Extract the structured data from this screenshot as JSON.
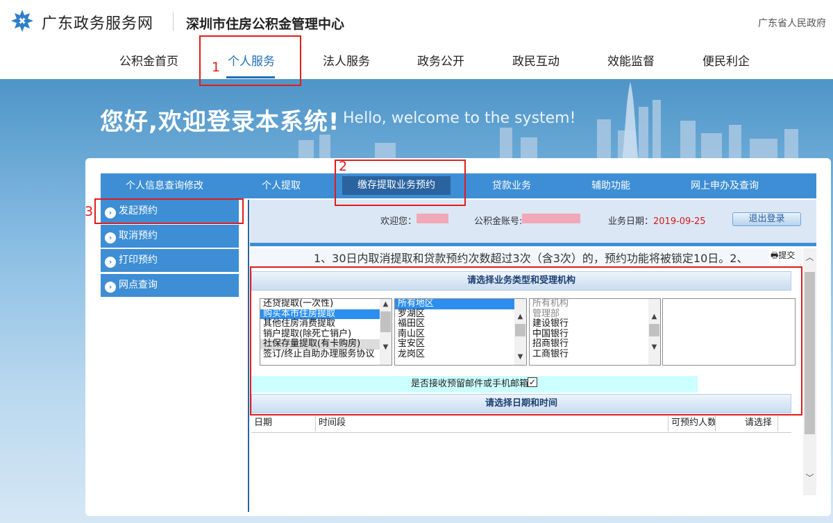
{
  "header": {
    "site_name": "广东政务服务网",
    "org_name": "深圳市住房公积金管理中心",
    "gov_link": "广东省人民政府"
  },
  "main_nav": [
    {
      "label": "公积金首页"
    },
    {
      "label": "个人服务",
      "active": true
    },
    {
      "label": "法人服务"
    },
    {
      "label": "政务公开"
    },
    {
      "label": "政民互动"
    },
    {
      "label": "效能监督"
    },
    {
      "label": "便民利企"
    }
  ],
  "banner": {
    "title": "您好,欢迎登录本系统!",
    "subtitle": "Hello, welcome to the system!"
  },
  "sub_nav": [
    {
      "label": "个人信息查询修改"
    },
    {
      "label": "个人提取"
    },
    {
      "label": "缴存提取业务预约",
      "active": true
    },
    {
      "label": "贷款业务"
    },
    {
      "label": "辅助功能"
    },
    {
      "label": "网上申办及查询"
    }
  ],
  "sidebar": [
    {
      "label": "发起预约"
    },
    {
      "label": "取消预约"
    },
    {
      "label": "打印预约"
    },
    {
      "label": "网点查询"
    }
  ],
  "info_bar": {
    "welcome_label": "欢迎您：",
    "account_label": "公积金账号:",
    "date_label": "业务日期：",
    "date_value": "2019-09-25",
    "logout_label": "退出登录"
  },
  "notice": "1、30日内取消提取和贷款预约次数超过3次（含3次）的，预约功能将被锁定10日。2、",
  "submit_label": "提交",
  "section1_title": "请选择业务类型和受理机构",
  "business_types": [
    "还贷提取(一次性)",
    "购买本市住房提取",
    "其他住房消费提取",
    "销户提取(除死亡销户)",
    "社保存量提取(有卡购房)",
    "签订/终止自助办理服务协议"
  ],
  "districts": [
    "所有地区",
    "罗湖区",
    "福田区",
    "南山区",
    "宝安区",
    "龙岗区"
  ],
  "institutions": [
    "所有机构",
    "管理部",
    "建设银行",
    "中国银行",
    "招商银行",
    "工商银行"
  ],
  "accept_notice": "是否接收预留邮件或手机邮箱",
  "checkbox_mark": "✓",
  "section2_title": "请选择日期和时间",
  "table_headers": [
    "日期",
    "时间段",
    "可预约人数",
    "请选择"
  ],
  "annotations": [
    "1",
    "2",
    "3"
  ],
  "colors": {
    "primary_blue": "#3d8ed4",
    "active_tab": "#2a63a0",
    "annotation_red": "#e21b1b",
    "date_red": "#d8161b"
  }
}
